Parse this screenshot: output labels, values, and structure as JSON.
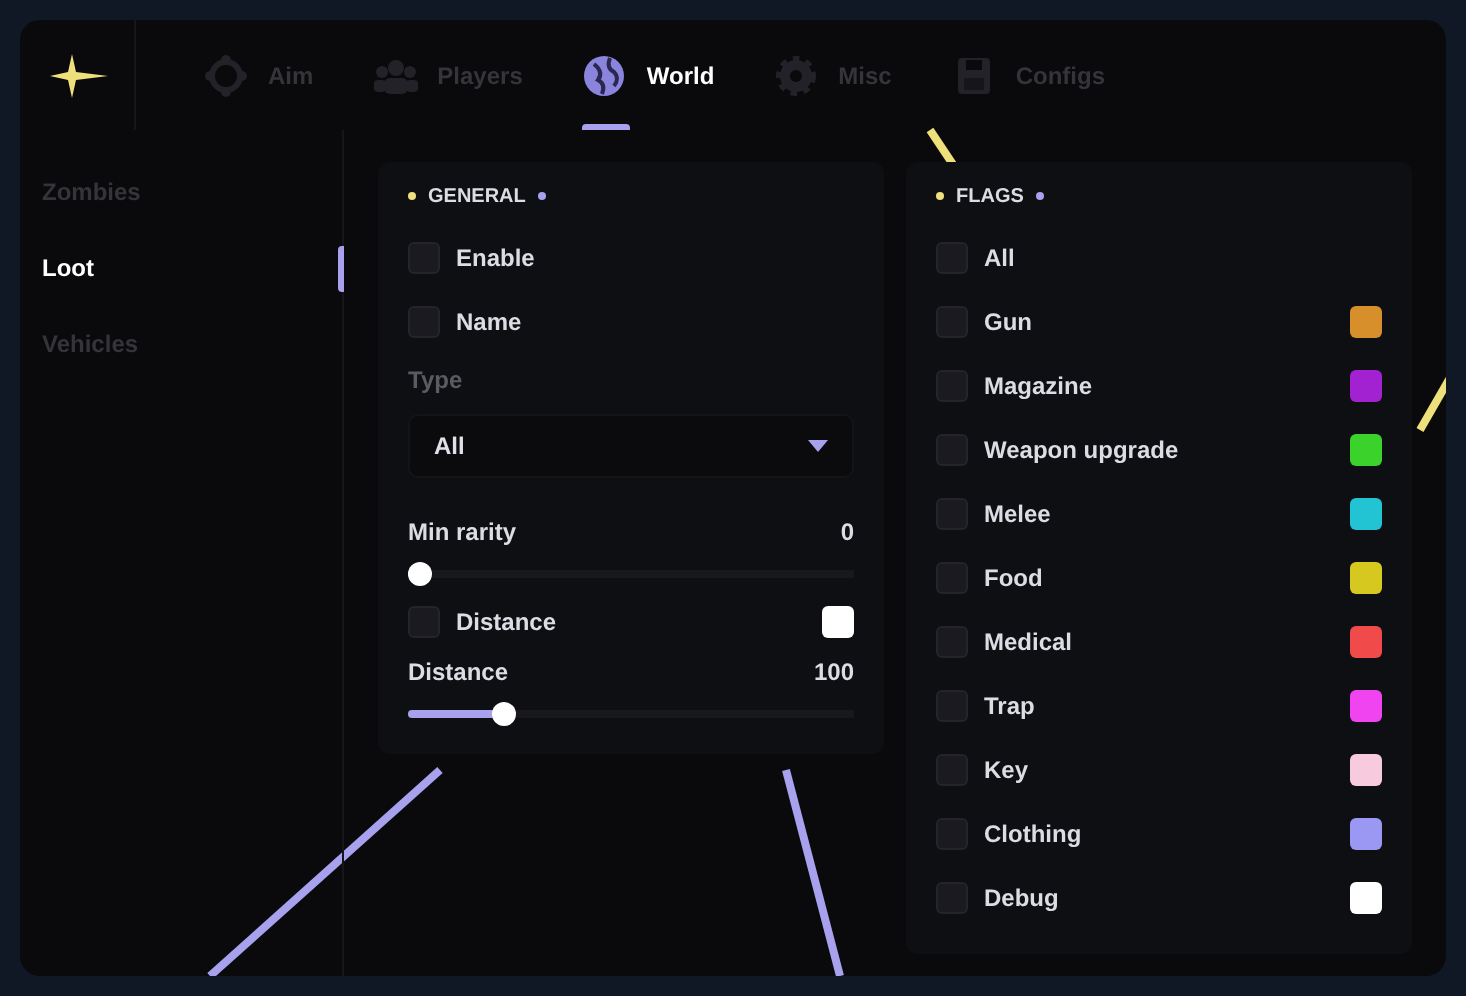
{
  "tabs": [
    {
      "label": "Aim",
      "selected": false
    },
    {
      "label": "Players",
      "selected": false
    },
    {
      "label": "World",
      "selected": true
    },
    {
      "label": "Misc",
      "selected": false
    },
    {
      "label": "Configs",
      "selected": false
    }
  ],
  "sidebar": {
    "items": [
      {
        "label": "Zombies",
        "selected": false
      },
      {
        "label": "Loot",
        "selected": true
      },
      {
        "label": "Vehicles",
        "selected": false
      }
    ]
  },
  "general": {
    "title": "GENERAL",
    "controls": [
      {
        "kind": "checkbox",
        "label": "Enable",
        "checked": false
      },
      {
        "kind": "checkbox",
        "label": "Name",
        "checked": false
      },
      {
        "kind": "dropdown",
        "label": "Type",
        "value": "All"
      },
      {
        "kind": "slider",
        "label": "Min rarity",
        "reading": "0",
        "level": 0
      },
      {
        "kind": "checkbox",
        "label": "Distance",
        "checked": false,
        "color": "#ffffff"
      },
      {
        "kind": "slider",
        "label": "Distance",
        "reading": "100",
        "level": 0.2
      }
    ]
  },
  "flags": {
    "title": "FLAGS",
    "items": [
      {
        "label": "All",
        "checked": false
      },
      {
        "label": "Gun",
        "checked": false,
        "color": "#d68f2a"
      },
      {
        "label": "Magazine",
        "checked": false,
        "color": "#a222d2"
      },
      {
        "label": "Weapon upgrade",
        "checked": false,
        "color": "#3cd22c"
      },
      {
        "label": "Melee",
        "checked": false,
        "color": "#22c4d4"
      },
      {
        "label": "Food",
        "checked": false,
        "color": "#d6c81e"
      },
      {
        "label": "Medical",
        "checked": false,
        "color": "#f04a4a"
      },
      {
        "label": "Trap",
        "checked": false,
        "color": "#f044f0"
      },
      {
        "label": "Key",
        "checked": false,
        "color": "#f8cade"
      },
      {
        "label": "Clothing",
        "checked": false,
        "color": "#9a98f2"
      },
      {
        "label": "Debug",
        "checked": false,
        "color": "#ffffff"
      }
    ]
  }
}
